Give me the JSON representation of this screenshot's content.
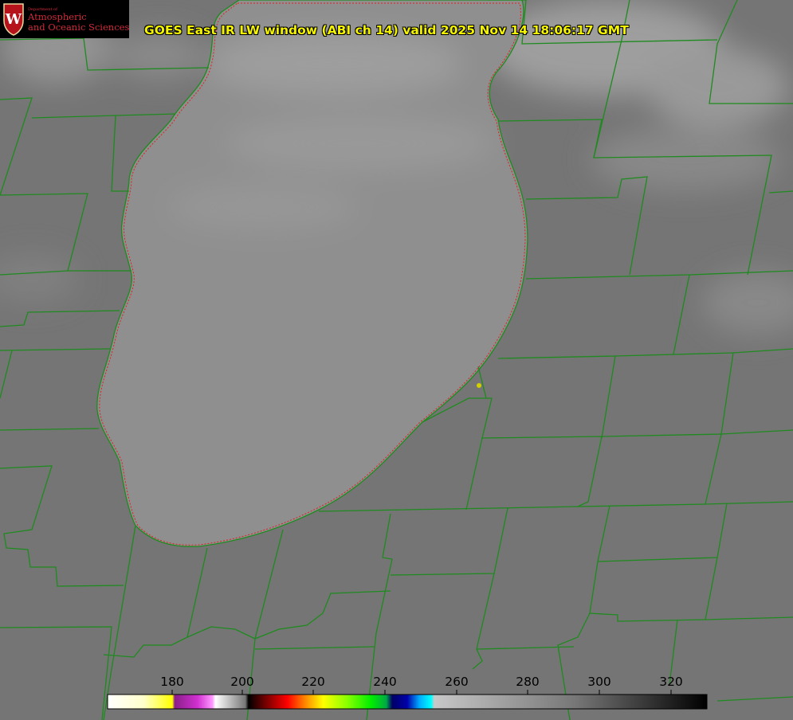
{
  "header": {
    "title": "GOES East IR LW window (ABI ch 14) valid 2025 Nov 14 18:06:17 GMT"
  },
  "logo": {
    "department_line": "Department of",
    "line1": "Atmospheric",
    "line2": "and Oceanic Sciences",
    "seal_letter": "W"
  },
  "colorbar": {
    "tick_labels": [
      "180",
      "200",
      "220",
      "240",
      "260",
      "280",
      "300",
      "320"
    ],
    "colors": {
      "yellow": "#ffff00",
      "magenta": "#d030d0",
      "red": "#ff0000",
      "green": "#00ee00",
      "blue": "#0000aa",
      "cyan": "#00ffff"
    }
  },
  "map": {
    "colors": {
      "land": "#757575",
      "lake": "#8f8f8f",
      "boundaries": "#1f8a1f",
      "coast_outline": "#e02020",
      "station_dot": "#d4d000"
    }
  }
}
